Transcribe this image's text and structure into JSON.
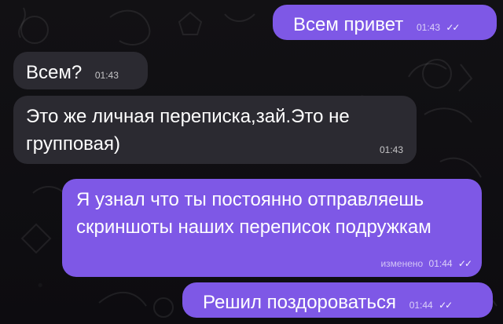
{
  "messages": [
    {
      "text": "Всем привет",
      "time": "01:43",
      "ticks": "✓✓",
      "edited": ""
    },
    {
      "text": "Всем?",
      "time": "01:43",
      "ticks": "",
      "edited": ""
    },
    {
      "text": "Это же личная переписка,зай.Это не групповая)",
      "time": "01:43",
      "ticks": "",
      "edited": ""
    },
    {
      "text": "Я узнал что ты постоянно отправляешь скриншоты наших переписок подружкам",
      "time": "01:44",
      "ticks": "✓✓",
      "edited": "изменено"
    },
    {
      "text": "Решил поздороваться",
      "time": "01:44",
      "ticks": "✓✓",
      "edited": ""
    }
  ]
}
